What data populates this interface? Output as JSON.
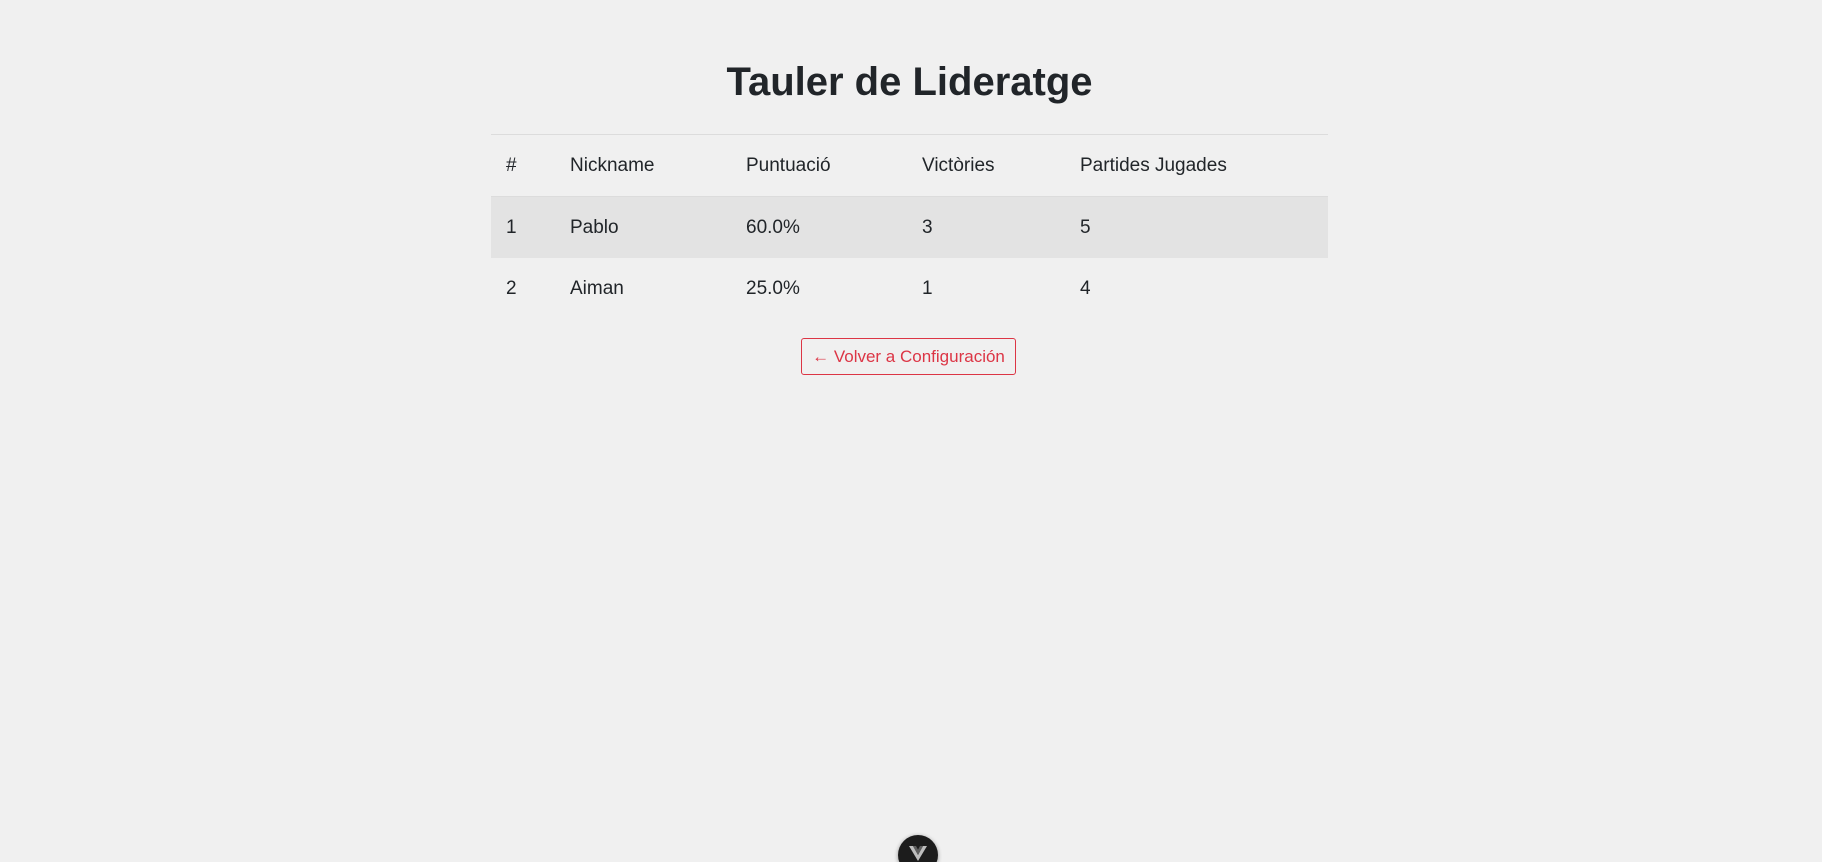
{
  "page": {
    "title": "Tauler de Lideratge"
  },
  "leaderboard": {
    "columns": [
      "#",
      "Nickname",
      "Puntuació",
      "Victòries",
      "Partides Jugades"
    ],
    "rows": [
      {
        "rank": "1",
        "nickname": "Pablo",
        "score": "60.0%",
        "wins": "3",
        "played": "5"
      },
      {
        "rank": "2",
        "nickname": "Aiman",
        "score": "25.0%",
        "wins": "1",
        "played": "4"
      }
    ]
  },
  "actions": {
    "back_label": "← Volver a Configuración"
  },
  "floating_button": {
    "icon": "vue-logo-icon"
  },
  "colors": {
    "background": "#f0f0f0",
    "accent": "#dc3545",
    "striped_row": "#e3e3e3"
  }
}
